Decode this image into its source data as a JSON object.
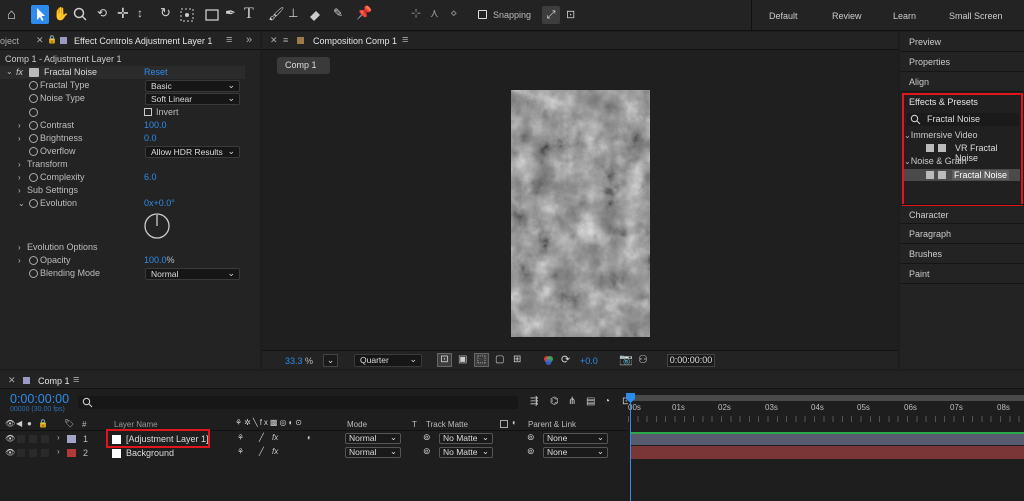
{
  "toolbar": {
    "snapping_label": "Snapping",
    "workspaces": [
      "Default",
      "Review",
      "Learn",
      "Small Screen"
    ]
  },
  "left_panel": {
    "tab_project": "oject",
    "tab_effect_controls": "Effect Controls Adjustment Layer 1",
    "layer_path": "Comp 1 - Adjustment Layer 1",
    "effect_name": "Fractal Noise",
    "reset_label": "Reset",
    "props": {
      "fractal_type": {
        "label": "Fractal Type",
        "value": "Basic"
      },
      "noise_type": {
        "label": "Noise Type",
        "value": "Soft Linear"
      },
      "invert": {
        "label": "Invert"
      },
      "contrast": {
        "label": "Contrast",
        "value": "100.0"
      },
      "brightness": {
        "label": "Brightness",
        "value": "0.0"
      },
      "overflow": {
        "label": "Overflow",
        "value": "Allow HDR Results"
      },
      "transform": {
        "label": "Transform"
      },
      "complexity": {
        "label": "Complexity",
        "value": "6.0"
      },
      "sub_settings": {
        "label": "Sub Settings"
      },
      "evolution": {
        "label": "Evolution",
        "value": "0x+0.0°"
      },
      "evolution_options": {
        "label": "Evolution Options"
      },
      "opacity": {
        "label": "Opacity",
        "value": "100.0",
        "unit": "%"
      },
      "blending_mode": {
        "label": "Blending Mode",
        "value": "Normal"
      }
    }
  },
  "composition": {
    "tab_label": "Composition Comp 1",
    "comp_button": "Comp 1",
    "zoom_value": "33.3",
    "zoom_unit": "%",
    "resolution": "Quarter",
    "exposure": "+0.0",
    "timecode": "0:00:00:00"
  },
  "right_panel": {
    "items_top": [
      "Preview",
      "Properties",
      "Align"
    ],
    "effects_title": "Effects & Presets",
    "search_value": "Fractal Noise",
    "tree": [
      {
        "category": "Immersive Video",
        "item": "VR Fractal Noise"
      },
      {
        "category": "Noise & Grain",
        "item": "Fractal Noise"
      }
    ],
    "items_bottom": [
      "Character",
      "Paragraph",
      "Brushes",
      "Paint"
    ]
  },
  "timeline": {
    "tab_label": "Comp 1",
    "timecode": "0:00:00:00",
    "frames_fps": "00000 (30.00 fps)",
    "headers": {
      "number": "#",
      "layer_name": "Layer Name",
      "mode": "Mode",
      "t": "T",
      "track_matte": "Track Matte",
      "parent": "Parent & Link"
    },
    "ruler": [
      "00s",
      "01s",
      "02s",
      "03s",
      "04s",
      "05s",
      "06s",
      "07s",
      "08s"
    ],
    "layers": [
      {
        "num": "1",
        "name": "[Adjustment Layer 1]",
        "mode": "Normal",
        "matte": "No Matte",
        "parent": "None",
        "label_color": "#a3a3c6",
        "bar_color": "#585a6e"
      },
      {
        "num": "2",
        "name": "Background",
        "mode": "Normal",
        "matte": "No Matte",
        "parent": "None",
        "label_color": "#b03a3a",
        "bar_color": "#7a3636"
      }
    ]
  }
}
